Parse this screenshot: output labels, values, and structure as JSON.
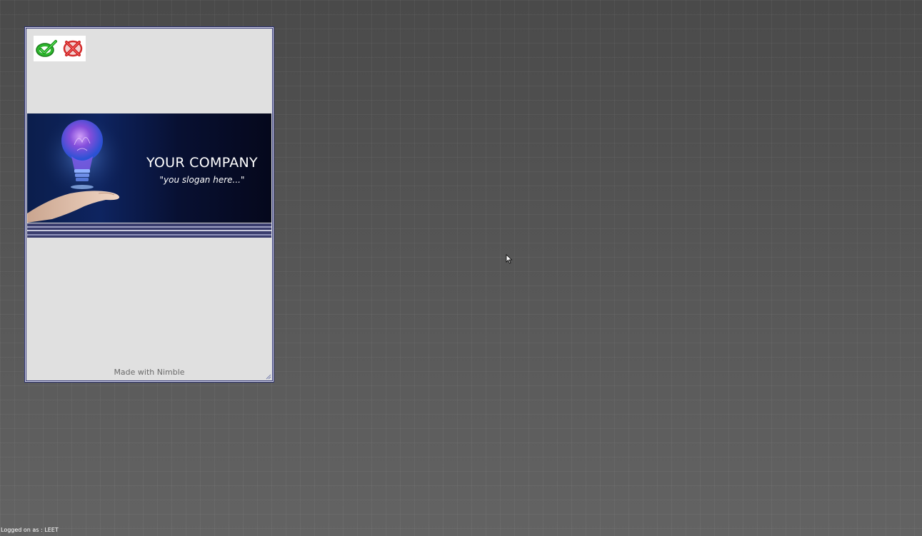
{
  "window": {
    "banner": {
      "company_name": "YOUR COMPANY",
      "slogan": "\"you slogan here...\""
    },
    "footer": "Made with Nimble"
  },
  "toolbar": {
    "buttons": [
      {
        "name": "confirm",
        "icon": "green-check-icon"
      },
      {
        "name": "cancel",
        "icon": "red-x-circle-icon"
      }
    ]
  },
  "status_bar": {
    "text": "Logged on as : LEET"
  },
  "colors": {
    "desktop": "#545454",
    "window_bg": "#e0e0e0",
    "window_border": "#2e3370",
    "confirm_green": "#2eb82e",
    "cancel_red": "#d42a2a",
    "banner_dark": "#05081c"
  }
}
